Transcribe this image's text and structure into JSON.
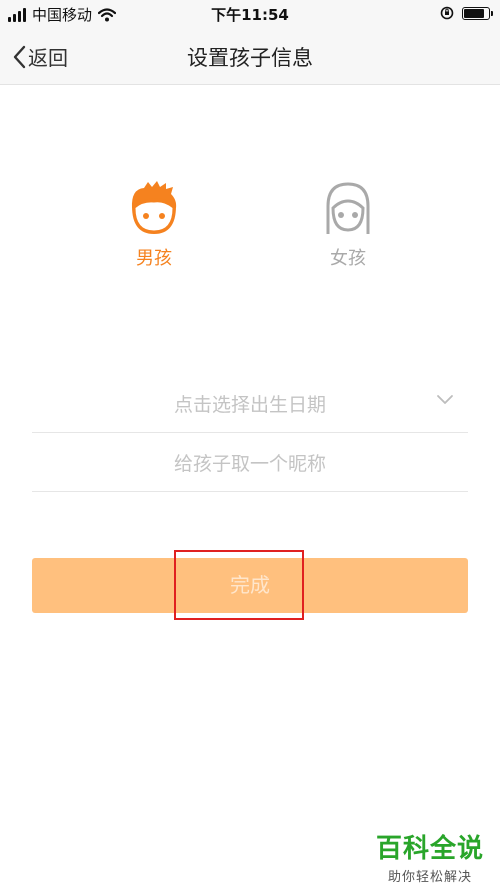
{
  "status_bar": {
    "carrier": "中国移动",
    "time": "下午11:54",
    "battery_level": 0.85
  },
  "nav": {
    "back_label": "返回",
    "title": "设置孩子信息"
  },
  "gender": {
    "boy_label": "男孩",
    "girl_label": "女孩",
    "selected": "boy"
  },
  "form": {
    "birthday_placeholder": "点击选择出生日期",
    "nickname_placeholder": "给孩子取一个昵称"
  },
  "done_button": {
    "label": "完成"
  },
  "watermark": {
    "title": "百科全说",
    "subtitle": "助你轻松解决"
  },
  "colors": {
    "accent": "#f5821f",
    "button_bg": "#ffc07e",
    "watermark_green": "#29a52a",
    "highlight_red": "#e02020"
  }
}
